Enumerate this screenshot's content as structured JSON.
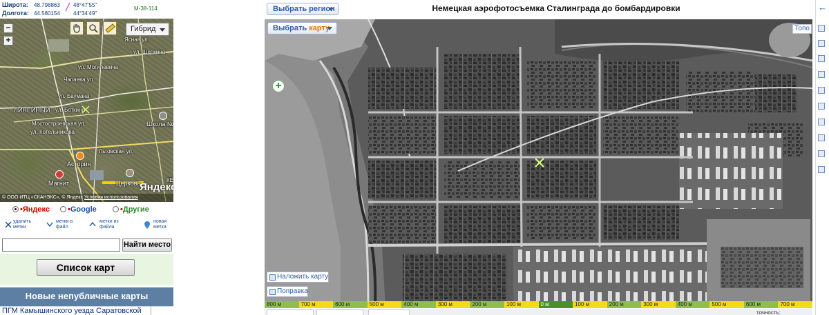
{
  "coordinates": {
    "lat_label": "Широта:",
    "lat_decimal": "48.798863",
    "lat_dms": "48°47'55\"",
    "lon_label": "Долгота:",
    "lon_decimal": "44.580154",
    "lon_dms": "44°34'49\"",
    "map_sheet": "M-38-114"
  },
  "minimap": {
    "layer_select": "Гибрид",
    "zoom_in": "+",
    "zoom_out": "−",
    "labels": {
      "shchepkina": "ул. Щепкина",
      "mogilevicha": "ул. Могилевича",
      "chapaeva": "Чапаева ул.",
      "baumana": "ул. Баумана",
      "lineyny": "ЛИНЕЙНЫЙ",
      "botkina": "ул. Боткина",
      "mostostroevskaya": "Мостостроевская ул.",
      "kotelnikova": "ул. Котельникова",
      "lgovskaya": "Льговская ул.",
      "astoria": "Астория",
      "magnit": "Магнит",
      "shkola": "Школа №",
      "tserkov": "Церковь",
      "yasnaya": "Ясная ул.",
      "ke": "КЕ"
    },
    "copyright": "© ООО ИТЦ «СКАНЭКС», © Яндекс",
    "terms_link": "Условия использования",
    "brand": "Яндекс"
  },
  "providers": [
    {
      "name": "Яндекс",
      "selected": true,
      "color": "#cc0000"
    },
    {
      "name": "Google",
      "selected": false,
      "color": "#1a4ea0"
    },
    {
      "name": "Другие",
      "selected": false,
      "color": "#2a8a2a"
    }
  ],
  "actions": {
    "delete_marks_1": "удалить",
    "delete_marks_2": "метки",
    "marks_to_file_1": "метки в",
    "marks_to_file_2": "файл",
    "marks_from_file_1": "метки из",
    "marks_from_file_2": "файла",
    "new_mark_1": "новая",
    "new_mark_2": "метка"
  },
  "search": {
    "value": "",
    "button": "Найти место"
  },
  "map_list_button": "Список карт",
  "new_maps": {
    "header": "Новые непубличные карты",
    "first_item": "ПГМ Камышинского уезда Саратовской"
  },
  "main": {
    "region_button": "Выбрать регион",
    "title": "Немецкая аэрофотосъемка Сталинграда до бомбардировки",
    "choose_map_prefix": "Выбрать",
    "choose_map_hl": "карту",
    "topo": "Топо",
    "zoom_plus": "+",
    "overlay_map": "Наложить карту",
    "fix": "Поправка",
    "scale": [
      {
        "label": "800 м",
        "c": "g"
      },
      {
        "label": "700 м",
        "c": "y"
      },
      {
        "label": "600 м",
        "c": "g"
      },
      {
        "label": "500 м",
        "c": "y"
      },
      {
        "label": "400 м",
        "c": "g"
      },
      {
        "label": "300 м",
        "c": "y"
      },
      {
        "label": "200 м",
        "c": "g"
      },
      {
        "label": "100 м",
        "c": "y"
      },
      {
        "label": "0 м",
        "c": "z"
      },
      {
        "label": "100 м",
        "c": "y"
      },
      {
        "label": "200 м",
        "c": "g"
      },
      {
        "label": "300 м",
        "c": "y"
      },
      {
        "label": "400 м",
        "c": "g"
      },
      {
        "label": "500 м",
        "c": "y"
      },
      {
        "label": "600 м",
        "c": "g"
      },
      {
        "label": "700 м",
        "c": "y"
      }
    ],
    "accuracy": "точность:"
  },
  "colors": {
    "link_blue": "#2d5fa8",
    "accent_orange": "#e07800",
    "new_maps_bar": "#5d7fa4"
  }
}
